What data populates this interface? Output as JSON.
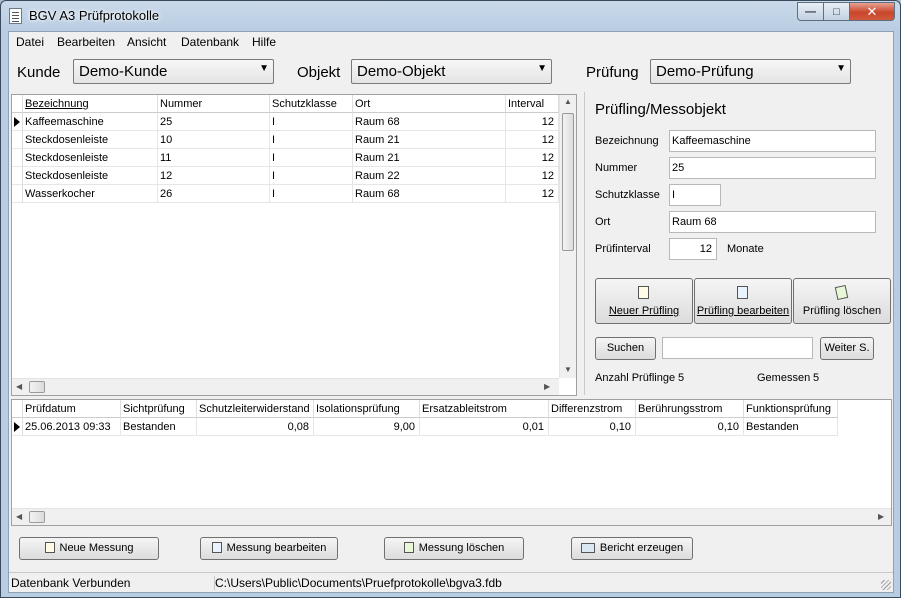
{
  "window": {
    "title": "BGV A3 Prüfprotokolle"
  },
  "menu": [
    "Datei",
    "Bearbeiten",
    "Ansicht",
    "Datenbank",
    "Hilfe"
  ],
  "selectors": {
    "kunde_label": "Kunde",
    "kunde_value": "Demo-Kunde",
    "objekt_label": "Objekt",
    "objekt_value": "Demo-Objekt",
    "pruefung_label": "Prüfung",
    "pruefung_value": "Demo-Prüfung"
  },
  "objects_grid": {
    "columns": [
      "Bezeichnung",
      "Nummer",
      "Schutzklasse",
      "Ort",
      "Interval"
    ],
    "rows": [
      [
        "Kaffeemaschine",
        "25",
        "I",
        "Raum 68",
        "12"
      ],
      [
        "Steckdosenleiste",
        "10",
        "I",
        "Raum 21",
        "12"
      ],
      [
        "Steckdosenleiste",
        "11",
        "I",
        "Raum 21",
        "12"
      ],
      [
        "Steckdosenleiste",
        "12",
        "I",
        "Raum 22",
        "12"
      ],
      [
        "Wasserkocher",
        "26",
        "I",
        "Raum 68",
        "12"
      ]
    ]
  },
  "detail": {
    "title": "Prüfling/Messobjekt",
    "bezeichnung_label": "Bezeichnung",
    "bezeichnung_value": "Kaffeemaschine",
    "nummer_label": "Nummer",
    "nummer_value": "25",
    "schutzklasse_label": "Schutzklasse",
    "schutzklasse_value": "I",
    "ort_label": "Ort",
    "ort_value": "Raum 68",
    "interval_label": "Prüfinterval",
    "interval_value": "12",
    "interval_unit": "Monate",
    "btn_new": "Neuer Prüfling",
    "btn_edit": "Prüfling bearbeiten",
    "btn_delete": "Prüfling löschen",
    "btn_search": "Suchen",
    "search_value": "",
    "btn_next": "Weiter S.",
    "count_label": "Anzahl Prüflinge",
    "count_value": "5",
    "measured_label": "Gemessen",
    "measured_value": "5"
  },
  "measurements_grid": {
    "columns": [
      "Prüfdatum",
      "Sichtprüfung",
      "Schutzleiterwiderstand",
      "Isolationsprüfung",
      "Ersatzableitstrom",
      "Differenzstrom",
      "Berührungsstrom",
      "Funktionsprüfung"
    ],
    "rows": [
      [
        "25.06.2013 09:33",
        "Bestanden",
        "0,08",
        "9,00",
        "0,01",
        "0,10",
        "0,10",
        "Bestanden"
      ]
    ]
  },
  "bottom_buttons": {
    "new": "Neue Messung",
    "edit": "Messung bearbeiten",
    "delete": "Messung löschen",
    "report": "Bericht erzeugen"
  },
  "status": {
    "db": "Datenbank Verbunden",
    "path": "C:\\Users\\Public\\Documents\\Pruefprotokolle\\bgva3.fdb"
  }
}
